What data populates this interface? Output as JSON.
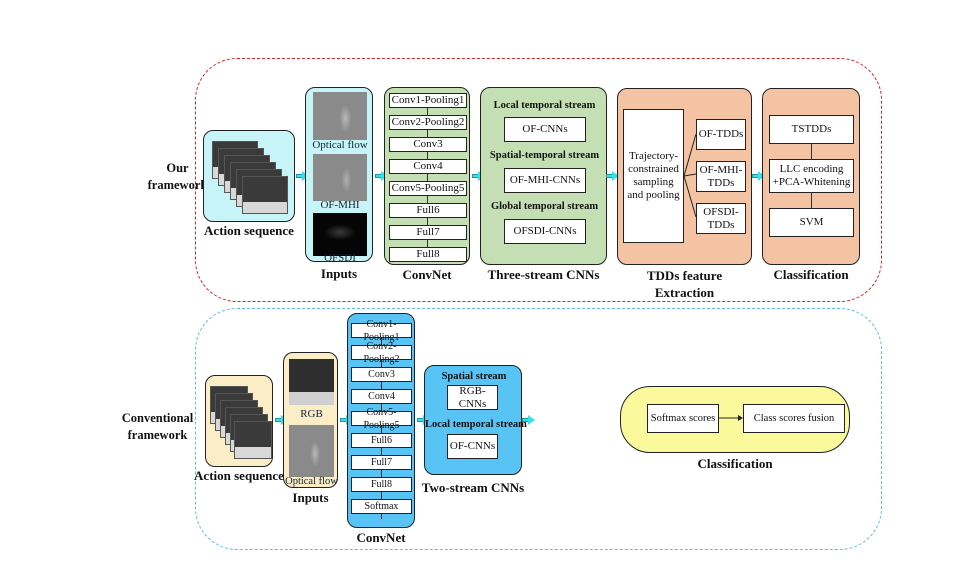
{
  "our": {
    "label_line1": "Our",
    "label_line2": "framework",
    "action_sequence": "Action sequence",
    "inputs": {
      "title": "Inputs",
      "items": [
        "Optical flow",
        "OF-MHI",
        "OFSDI"
      ]
    },
    "convnet": {
      "title": "ConvNet",
      "layers": [
        "Conv1-Pooling1",
        "Conv2-Pooling2",
        "Conv3",
        "Conv4",
        "Conv5-Pooling5",
        "Full6",
        "Full7",
        "Full8"
      ]
    },
    "three_stream": {
      "title": "Three-stream CNNs",
      "streams": [
        {
          "name": "Local temporal stream",
          "net": "OF-CNNs"
        },
        {
          "name": "Spatial-temporal stream",
          "net": "OF-MHI-CNNs"
        },
        {
          "name": "Global temporal stream",
          "net": "OFSDI-CNNs"
        }
      ]
    },
    "tdds": {
      "title_line1": "TDDs feature",
      "title_line2": "Extraction",
      "sampling": "Trajectory-constrained sampling and pooling",
      "outputs": [
        "OF-TDDs",
        "OF-MHI-TDDs",
        "OFSDI-TDDs"
      ]
    },
    "classification": {
      "title": "Classification",
      "steps": [
        "TSTDDs",
        "LLC encoding +PCA-Whitening",
        "SVM"
      ]
    }
  },
  "conventional": {
    "label_line1": "Conventional",
    "label_line2": "framework",
    "action_sequence": "Action sequence",
    "inputs": {
      "title": "Inputs",
      "items": [
        "RGB",
        "Optical flow"
      ]
    },
    "convnet": {
      "title": "ConvNet",
      "layers": [
        "Conv1-Pooling1",
        "Conv2-Pooling2",
        "Conv3",
        "Conv4",
        "Conv5-Pooling5",
        "Full6",
        "Full7",
        "Full8",
        "Softmax"
      ]
    },
    "two_stream": {
      "title": "Two-stream CNNs",
      "streams": [
        {
          "name": "Spatial stream",
          "net": "RGB-CNNs"
        },
        {
          "name": "Local temporal stream",
          "net": "OF-CNNs"
        }
      ]
    },
    "classification": {
      "title": "Classification",
      "steps": [
        "Softmax scores",
        "Class scores fusion"
      ]
    }
  },
  "colors": {
    "our_border": "#e02020",
    "conv_border": "#5cc0e6",
    "cyan": "#c6f4f7",
    "green": "#c5dfb4",
    "peach": "#f4c3a3",
    "beige": "#fbeec7",
    "blue": "#58c3f5",
    "yellow": "#fafa9c"
  }
}
